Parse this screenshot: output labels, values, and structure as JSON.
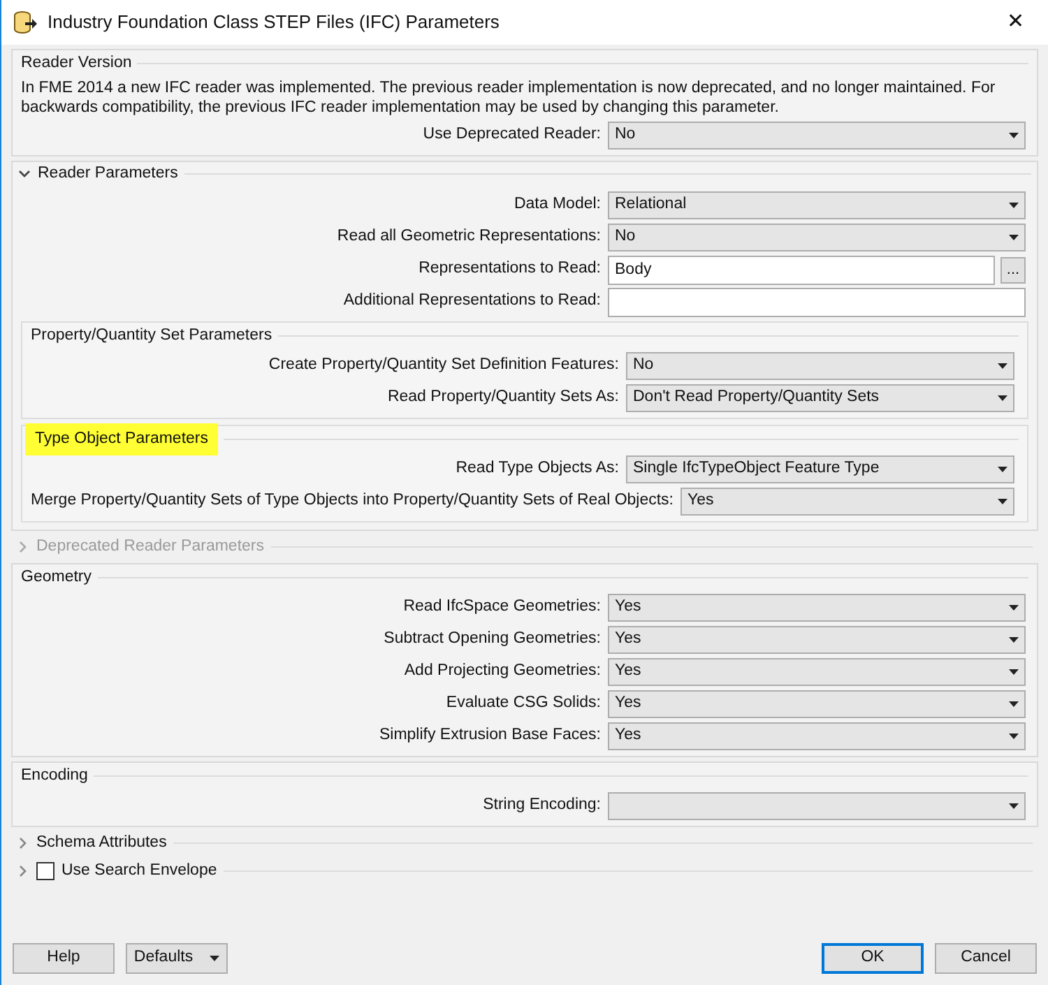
{
  "window": {
    "title": "Industry Foundation Class STEP Files (IFC) Parameters",
    "close": "✕"
  },
  "sections": [
    {
      "kind": "group",
      "title": "Reader Version",
      "description": "In FME 2014 a new IFC reader was implemented. The previous reader implementation is now deprecated, and no longer maintained. For backwards compatibility, the previous IFC reader implementation may be used by changing this parameter.",
      "rows": [
        {
          "kind": "dropdown",
          "label": "Use Deprecated Reader:",
          "value": "No"
        }
      ]
    },
    {
      "kind": "collapsible",
      "title": "Reader Parameters",
      "expanded": true,
      "disabled": false,
      "rows": [
        {
          "kind": "dropdown",
          "label": "Data Model:",
          "value": "Relational"
        },
        {
          "kind": "dropdown",
          "label": "Read all Geometric Representations:",
          "value": "No"
        },
        {
          "kind": "browse",
          "label": "Representations to Read:",
          "value": "Body",
          "button": "..."
        },
        {
          "kind": "text",
          "label": "Additional Representations to Read:",
          "value": ""
        }
      ],
      "subgroups": [
        {
          "title": "Property/Quantity Set Parameters",
          "highlighted": false,
          "rows": [
            {
              "kind": "dropdown",
              "label": "Create Property/Quantity Set Definition Features:",
              "value": "No"
            },
            {
              "kind": "dropdown",
              "label": "Read Property/Quantity Sets As:",
              "value": "Don't Read Property/Quantity Sets"
            }
          ]
        },
        {
          "title": "Type Object Parameters",
          "highlighted": true,
          "rows": [
            {
              "kind": "dropdown",
              "label": "Read Type Objects As:",
              "value": "Single IfcTypeObject Feature Type"
            },
            {
              "kind": "dropdown",
              "label": "Merge Property/Quantity Sets of Type Objects into Property/Quantity Sets of Real Objects:",
              "value": "Yes"
            }
          ]
        }
      ]
    },
    {
      "kind": "collapsible",
      "title": "Deprecated Reader Parameters",
      "expanded": false,
      "disabled": true
    },
    {
      "kind": "group",
      "title": "Geometry",
      "rows": [
        {
          "kind": "dropdown",
          "label": "Read IfcSpace Geometries:",
          "value": "Yes"
        },
        {
          "kind": "dropdown",
          "label": "Subtract Opening Geometries:",
          "value": "Yes"
        },
        {
          "kind": "dropdown",
          "label": "Add Projecting Geometries:",
          "value": "Yes"
        },
        {
          "kind": "dropdown",
          "label": "Evaluate CSG Solids:",
          "value": "Yes"
        },
        {
          "kind": "dropdown",
          "label": "Simplify Extrusion Base Faces:",
          "value": "Yes"
        }
      ]
    },
    {
      "kind": "group",
      "title": "Encoding",
      "rows": [
        {
          "kind": "dropdown",
          "label": "String Encoding:",
          "value": ""
        }
      ]
    },
    {
      "kind": "collapsible",
      "title": "Schema Attributes",
      "expanded": false,
      "disabled": false
    },
    {
      "kind": "collapsible",
      "title": "Use Search Envelope",
      "expanded": false,
      "disabled": false,
      "checkbox": {
        "checked": false
      }
    }
  ],
  "buttons": [
    {
      "label": "Help",
      "kind": "plain",
      "selected": false
    },
    {
      "label": "Defaults",
      "kind": "menu",
      "selected": false
    },
    {
      "label": "OK",
      "kind": "plain",
      "selected": true
    },
    {
      "label": "Cancel",
      "kind": "plain",
      "selected": false
    }
  ]
}
